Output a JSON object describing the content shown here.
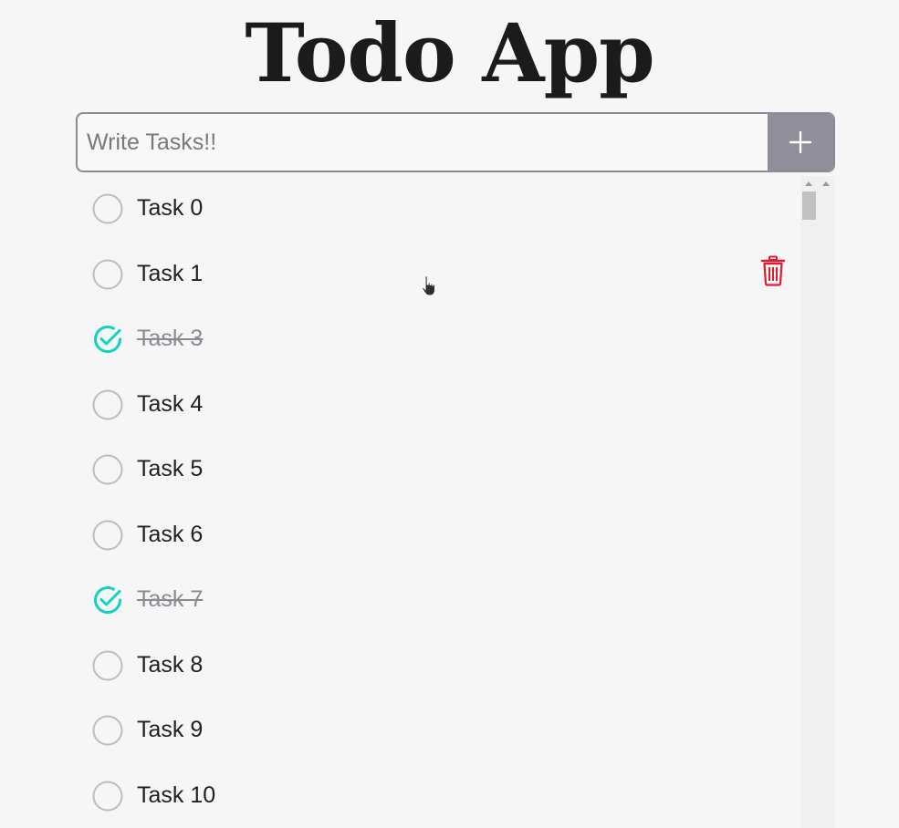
{
  "app": {
    "title": "Todo App"
  },
  "input": {
    "placeholder": "Write Tasks!!",
    "value": "",
    "add_icon": "plus-icon"
  },
  "tasks": [
    {
      "label": "Task 0",
      "done": false
    },
    {
      "label": "Task 1",
      "done": false,
      "hovered": true
    },
    {
      "label": "Task 3",
      "done": true
    },
    {
      "label": "Task 4",
      "done": false
    },
    {
      "label": "Task 5",
      "done": false
    },
    {
      "label": "Task 6",
      "done": false
    },
    {
      "label": "Task 7",
      "done": true
    },
    {
      "label": "Task 8",
      "done": false
    },
    {
      "label": "Task 9",
      "done": false
    },
    {
      "label": "Task 10",
      "done": false
    }
  ],
  "icons": {
    "unchecked": "circle-icon",
    "checked": "check-circle-icon",
    "delete": "trash-icon"
  },
  "colors": {
    "checked": "#12d3c0",
    "unchecked": "#bcbcc4",
    "delete": "#e11b2e",
    "add_button_bg": "#908e9b",
    "input_border": "#8c8a96",
    "title": "#1b1b1b"
  }
}
